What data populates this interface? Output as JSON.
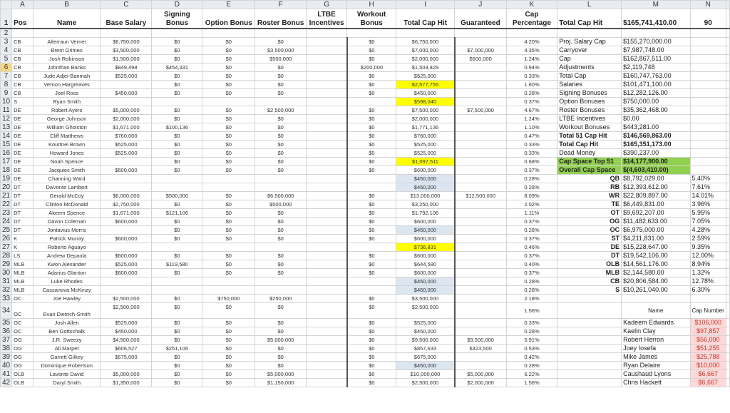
{
  "columns": [
    "A",
    "B",
    "C",
    "D",
    "E",
    "F",
    "G",
    "H",
    "I",
    "J",
    "K",
    "L",
    "M",
    "N"
  ],
  "header": {
    "pos": "Pos",
    "name": "Name",
    "base": "Base Salary",
    "signing": "Signing Bonus",
    "option": "Option Bonus",
    "roster": "Roster Bonus",
    "ltbe": "LTBE Incentives",
    "workout": "Workout Bonus",
    "total": "Total Cap Hit",
    "guaranteed": "Guaranteed",
    "cap_pct": "Cap Percentage",
    "l_label": "Total Cap Hit",
    "m_value": "$165,741,410.00",
    "n_value": "90"
  },
  "players": [
    {
      "row": "3",
      "pos": "CB",
      "name": "Alterraun Verner",
      "base": "$6,750,000",
      "signing": "$0",
      "option": "$0",
      "roster": "$0",
      "ltbe": "",
      "workout": "$0",
      "total": "$6,750,000",
      "guaranteed": "",
      "pct": "4.20%",
      "hl": ""
    },
    {
      "row": "4",
      "pos": "CB",
      "name": "Brent Grimes",
      "base": "$3,500,000",
      "signing": "$0",
      "option": "$0",
      "roster": "$3,500,000",
      "ltbe": "",
      "workout": "$0",
      "total": "$7,000,000",
      "guaranteed": "$7,000,000",
      "pct": "4.35%",
      "hl": ""
    },
    {
      "row": "5",
      "pos": "CB",
      "name": "Josh Robinson",
      "base": "$1,500,000",
      "signing": "$0",
      "option": "$0",
      "roster": "$500,000",
      "ltbe": "",
      "workout": "$0",
      "total": "$2,000,000",
      "guaranteed": "$500,000",
      "pct": "1.24%",
      "hl": ""
    },
    {
      "row": "6",
      "pos": "CB",
      "name": "Johnthan Banks",
      "base": "$849,498",
      "signing": "$454,331",
      "option": "$0",
      "roster": "$0",
      "ltbe": "",
      "workout": "$200,000",
      "total": "$1,503,829",
      "guaranteed": "",
      "pct": "0.94%",
      "hl": ""
    },
    {
      "row": "7",
      "pos": "CB",
      "name": "Jude Adjei-Barimah",
      "base": "$525,000",
      "signing": "$0",
      "option": "$0",
      "roster": "$0",
      "ltbe": "",
      "workout": "$0",
      "total": "$525,000",
      "guaranteed": "",
      "pct": "0.33%",
      "hl": ""
    },
    {
      "row": "8",
      "pos": "CB",
      "name": "Vernon Hargreaves",
      "base": "",
      "signing": "$0",
      "option": "$0",
      "roster": "$0",
      "ltbe": "",
      "workout": "$0",
      "total": "$2,577,755",
      "guaranteed": "",
      "pct": "1.60%",
      "hl": "yellow"
    },
    {
      "row": "9",
      "pos": "CB",
      "name": "Joel Ross",
      "base": "$450,000",
      "signing": "$0",
      "option": "$0",
      "roster": "$0",
      "ltbe": "",
      "workout": "$0",
      "total": "$450,000",
      "guaranteed": "",
      "pct": "0.28%",
      "hl": ""
    },
    {
      "row": "10",
      "pos": "S",
      "name": "Ryan Smith",
      "base": "",
      "signing": "",
      "option": "",
      "roster": "",
      "ltbe": "",
      "workout": "",
      "total": "$598,040",
      "guaranteed": "",
      "pct": "0.37%",
      "hl": "yellow"
    },
    {
      "row": "11",
      "pos": "DE",
      "name": "Robert Ayers",
      "base": "$5,000,000",
      "signing": "$0",
      "option": "$0",
      "roster": "$2,500,000",
      "ltbe": "",
      "workout": "$0",
      "total": "$7,500,000",
      "guaranteed": "$7,500,000",
      "pct": "4.67%",
      "hl": ""
    },
    {
      "row": "12",
      "pos": "DE",
      "name": "George Johnson",
      "base": "$2,000,000",
      "signing": "$0",
      "option": "$0",
      "roster": "$0",
      "ltbe": "",
      "workout": "$0",
      "total": "$2,000,000",
      "guaranteed": "",
      "pct": "1.24%",
      "hl": ""
    },
    {
      "row": "13",
      "pos": "DE",
      "name": "William Gholston",
      "base": "$1,671,000",
      "signing": "$100,136",
      "option": "$0",
      "roster": "$0",
      "ltbe": "",
      "workout": "$0",
      "total": "$1,771,136",
      "guaranteed": "",
      "pct": "1.10%",
      "hl": ""
    },
    {
      "row": "14",
      "pos": "DE",
      "name": "Cliff Matthews",
      "base": "$760,000",
      "signing": "$0",
      "option": "$0",
      "roster": "$0",
      "ltbe": "",
      "workout": "$0",
      "total": "$760,000",
      "guaranteed": "",
      "pct": "0.47%",
      "hl": ""
    },
    {
      "row": "15",
      "pos": "DE",
      "name": "Kourtnei Brown",
      "base": "$525,000",
      "signing": "$0",
      "option": "$0",
      "roster": "$0",
      "ltbe": "",
      "workout": "$0",
      "total": "$525,000",
      "guaranteed": "",
      "pct": "0.33%",
      "hl": ""
    },
    {
      "row": "16",
      "pos": "DE",
      "name": "Howard Jones",
      "base": "$525,000",
      "signing": "$0",
      "option": "$0",
      "roster": "$0",
      "ltbe": "",
      "workout": "$0",
      "total": "$525,000",
      "guaranteed": "",
      "pct": "0.33%",
      "hl": ""
    },
    {
      "row": "17",
      "pos": "DE",
      "name": "Noah Spence",
      "base": "",
      "signing": "$0",
      "option": "$0",
      "roster": "$0",
      "ltbe": "",
      "workout": "$0",
      "total": "$1,097,511",
      "guaranteed": "",
      "pct": "0.68%",
      "hl": "yellow"
    },
    {
      "row": "18",
      "pos": "DE",
      "name": "Jacquies Smith",
      "base": "$600,000",
      "signing": "$0",
      "option": "$0",
      "roster": "$0",
      "ltbe": "",
      "workout": "$0",
      "total": "$600,000",
      "guaranteed": "",
      "pct": "0.37%",
      "hl": ""
    },
    {
      "row": "19",
      "pos": "DE",
      "name": "Channing Ward",
      "base": "",
      "signing": "",
      "option": "",
      "roster": "",
      "ltbe": "",
      "workout": "",
      "total": "$450,000",
      "guaranteed": "",
      "pct": "0.28%",
      "hl": "blue"
    },
    {
      "row": "20",
      "pos": "DT",
      "name": "DaVonte Lambert",
      "base": "",
      "signing": "",
      "option": "",
      "roster": "",
      "ltbe": "",
      "workout": "",
      "total": "$450,000",
      "guaranteed": "",
      "pct": "0.28%",
      "hl": "blue"
    },
    {
      "row": "21",
      "pos": "DT",
      "name": "Gerald McCoy",
      "base": "$6,000,000",
      "signing": "$500,000",
      "option": "$0",
      "roster": "$6,500,000",
      "ltbe": "",
      "workout": "$0",
      "total": "$13,000,000",
      "guaranteed": "$12,500,000",
      "pct": "8.09%",
      "hl": ""
    },
    {
      "row": "22",
      "pos": "DT",
      "name": "Clinton McDonald",
      "base": "$2,750,000",
      "signing": "$0",
      "option": "$0",
      "roster": "$500,000",
      "ltbe": "",
      "workout": "$0",
      "total": "$3,250,000",
      "guaranteed": "",
      "pct": "2.02%",
      "hl": ""
    },
    {
      "row": "23",
      "pos": "DT",
      "name": "Akeem Spence",
      "base": "$1,671,000",
      "signing": "$121,106",
      "option": "$0",
      "roster": "$0",
      "ltbe": "",
      "workout": "$0",
      "total": "$1,792,106",
      "guaranteed": "",
      "pct": "1.11%",
      "hl": ""
    },
    {
      "row": "24",
      "pos": "DT",
      "name": "Davon Coleman",
      "base": "$600,000",
      "signing": "$0",
      "option": "$0",
      "roster": "$0",
      "ltbe": "",
      "workout": "$0",
      "total": "$600,000",
      "guaranteed": "",
      "pct": "0.37%",
      "hl": ""
    },
    {
      "row": "25",
      "pos": "DT",
      "name": "Jontavius Morris",
      "base": "",
      "signing": "$0",
      "option": "$0",
      "roster": "$0",
      "ltbe": "",
      "workout": "$0",
      "total": "$450,000",
      "guaranteed": "",
      "pct": "0.28%",
      "hl": "blue"
    },
    {
      "row": "26",
      "pos": "K",
      "name": "Patrick Murray",
      "base": "$600,000",
      "signing": "$0",
      "option": "$0",
      "roster": "$0",
      "ltbe": "",
      "workout": "$0",
      "total": "$600,000",
      "guaranteed": "",
      "pct": "0.37%",
      "hl": ""
    },
    {
      "row": "27",
      "pos": "K",
      "name": "Roberto Aguayo",
      "base": "",
      "signing": "",
      "option": "",
      "roster": "",
      "ltbe": "",
      "workout": "",
      "total": "$736,831",
      "guaranteed": "",
      "pct": "0.46%",
      "hl": "yellow"
    },
    {
      "row": "28",
      "pos": "LS",
      "name": "Andrew Depaola",
      "base": "$600,000",
      "signing": "$0",
      "option": "$0",
      "roster": "$0",
      "ltbe": "",
      "workout": "$0",
      "total": "$600,000",
      "guaranteed": "",
      "pct": "0.37%",
      "hl": ""
    },
    {
      "row": "29",
      "pos": "MLB",
      "name": "Kwon Alexander",
      "base": "$525,000",
      "signing": "$119,580",
      "option": "$0",
      "roster": "$0",
      "ltbe": "",
      "workout": "$0",
      "total": "$644,580",
      "guaranteed": "",
      "pct": "0.40%",
      "hl": ""
    },
    {
      "row": "30",
      "pos": "MLB",
      "name": "Adarius Glanton",
      "base": "$600,000",
      "signing": "$0",
      "option": "$0",
      "roster": "$0",
      "ltbe": "",
      "workout": "$0",
      "total": "$600,000",
      "guaranteed": "",
      "pct": "0.37%",
      "hl": ""
    },
    {
      "row": "31",
      "pos": "MLB",
      "name": "Luke Rhodes",
      "base": "",
      "signing": "",
      "option": "",
      "roster": "",
      "ltbe": "",
      "workout": "",
      "total": "$450,000",
      "guaranteed": "",
      "pct": "0.28%",
      "hl": "blue"
    },
    {
      "row": "32",
      "pos": "MLB",
      "name": "Cassanova McKinzy",
      "base": "",
      "signing": "",
      "option": "",
      "roster": "",
      "ltbe": "",
      "workout": "",
      "total": "$450,000",
      "guaranteed": "",
      "pct": "0.28%",
      "hl": "blue"
    },
    {
      "row": "33",
      "pos": "OC",
      "name": "Joe Hawley",
      "base": "$2,500,000",
      "signing": "$0",
      "option": "$750,000",
      "roster": "$250,000",
      "ltbe": "",
      "workout": "$0",
      "total": "$3,500,000",
      "guaranteed": "",
      "pct": "2.18%",
      "hl": ""
    },
    {
      "row": "34",
      "pos": "OC",
      "name": "Evan Dietrich-Smith",
      "base": "$2,500,000",
      "signing": "$0",
      "option": "$0",
      "roster": "$0",
      "ltbe": "",
      "workout": "$0",
      "total": "$2,500,000",
      "guaranteed": "",
      "pct": "1.56%",
      "hl": "",
      "tall": true
    },
    {
      "row": "35",
      "pos": "OC",
      "name": "Josh Allen",
      "base": "$525,000",
      "signing": "$0",
      "option": "$0",
      "roster": "$0",
      "ltbe": "",
      "workout": "$0",
      "total": "$525,000",
      "guaranteed": "",
      "pct": "0.33%",
      "hl": ""
    },
    {
      "row": "36",
      "pos": "OC",
      "name": "Ben Gottschalk",
      "base": "$450,000",
      "signing": "$0",
      "option": "$0",
      "roster": "$0",
      "ltbe": "",
      "workout": "$0",
      "total": "$450,000",
      "guaranteed": "",
      "pct": "0.28%",
      "hl": ""
    },
    {
      "row": "37",
      "pos": "OG",
      "name": "J.R. Sweezy",
      "base": "$4,500,000",
      "signing": "$0",
      "option": "$0",
      "roster": "$5,000,000",
      "ltbe": "",
      "workout": "$0",
      "total": "$9,500,000",
      "guaranteed": "$9,500,000",
      "pct": "5.91%",
      "hl": ""
    },
    {
      "row": "38",
      "pos": "OG",
      "name": "Ali Marpet",
      "base": "$606,527",
      "signing": "$251,106",
      "option": "$0",
      "roster": "$0",
      "ltbe": "",
      "workout": "$0",
      "total": "$857,633",
      "guaranteed": "$323,500",
      "pct": "0.53%",
      "hl": ""
    },
    {
      "row": "39",
      "pos": "OG",
      "name": "Garrett Gilkey",
      "base": "$675,000",
      "signing": "$0",
      "option": "$0",
      "roster": "$0",
      "ltbe": "",
      "workout": "$0",
      "total": "$675,000",
      "guaranteed": "",
      "pct": "0.42%",
      "hl": ""
    },
    {
      "row": "40",
      "pos": "OG",
      "name": "Dominique Robertson",
      "base": "",
      "signing": "$0",
      "option": "$0",
      "roster": "$0",
      "ltbe": "",
      "workout": "$0",
      "total": "$450,000",
      "guaranteed": "",
      "pct": "0.28%",
      "hl": "blue"
    },
    {
      "row": "41",
      "pos": "OLB",
      "name": "Lavonte David",
      "base": "$5,000,000",
      "signing": "$0",
      "option": "$0",
      "roster": "$5,000,000",
      "ltbe": "",
      "workout": "$0",
      "total": "$10,000,000",
      "guaranteed": "$5,000,000",
      "pct": "6.22%",
      "hl": ""
    },
    {
      "row": "42",
      "pos": "OLB",
      "name": "Daryl Smith",
      "base": "$1,350,000",
      "signing": "$0",
      "option": "$0",
      "roster": "$1,150,000",
      "ltbe": "",
      "workout": "$0",
      "total": "$2,500,000",
      "guaranteed": "$2,000,000",
      "pct": "1.56%",
      "hl": ""
    }
  ],
  "summary": [
    {
      "label": "Proj. Salary Cap",
      "value": "$155,270,000.00",
      "bold": false,
      "green": false
    },
    {
      "label": "Carryover",
      "value": "$7,987,748.00",
      "bold": false,
      "green": false
    },
    {
      "label": "Cap",
      "value": "$162,867,511.00",
      "bold": false,
      "green": false
    },
    {
      "label": "Adjustments",
      "value": "$2,119,748",
      "bold": false,
      "green": false
    },
    {
      "label": "Total Cap",
      "value": "$160,747,763.00",
      "bold": false,
      "green": false
    },
    {
      "label": "Salaries",
      "value": "$101,471,100.00",
      "bold": false,
      "green": false
    },
    {
      "label": "Signing Bonuses",
      "value": "$12,282,126.00",
      "bold": false,
      "green": false
    },
    {
      "label": "Option Bonuses",
      "value": "$750,000.00",
      "bold": false,
      "green": false
    },
    {
      "label": "Roster Bonuses",
      "value": "$35,362,468.00",
      "bold": false,
      "green": false
    },
    {
      "label": "LTBE Incentives",
      "value": "$0.00",
      "bold": false,
      "green": false
    },
    {
      "label": "Workout Bonuses",
      "value": "$443,281.00",
      "bold": false,
      "green": false
    },
    {
      "label": "Total 51 Cap Hit",
      "value": "$146,569,863.00",
      "bold": true,
      "green": false
    },
    {
      "label": "Total Cap Hit",
      "value": "$165,351,173.00",
      "bold": true,
      "green": false
    },
    {
      "label": "Dead Money",
      "value": "$390,237.00",
      "bold": false,
      "green": false
    },
    {
      "label": "Cap Space Top 51",
      "value": "$14,177,900.00",
      "bold": true,
      "green": true
    },
    {
      "label": "Overall Cap Space",
      "value": "$(4,603,410.00)",
      "bold": true,
      "green": true
    }
  ],
  "positions": [
    {
      "pos": "QB",
      "value": "$8,792,029.00",
      "pct": "5.40%"
    },
    {
      "pos": "RB",
      "value": "$12,393,612.00",
      "pct": "7.61%"
    },
    {
      "pos": "WR",
      "value": "$22,809,897.00",
      "pct": "14.01%"
    },
    {
      "pos": "TE",
      "value": "$6,449,831.00",
      "pct": "3.96%"
    },
    {
      "pos": "OT",
      "value": "$9,692,207.00",
      "pct": "5.95%"
    },
    {
      "pos": "OG",
      "value": "$11,482,633.00",
      "pct": "7.05%"
    },
    {
      "pos": "OC",
      "value": "$6,975,000.00",
      "pct": "4.28%"
    },
    {
      "pos": "ST",
      "value": "$4,211,831.00",
      "pct": "2.59%"
    },
    {
      "pos": "DE",
      "value": "$15,228,647.00",
      "pct": "9.35%"
    },
    {
      "pos": "DT",
      "value": "$19,542,106.00",
      "pct": "12.00%"
    },
    {
      "pos": "OLB",
      "value": "$14,561,176.00",
      "pct": "8.94%"
    },
    {
      "pos": "MLB",
      "value": "$2,144,580.00",
      "pct": "1.32%"
    },
    {
      "pos": "CB",
      "value": "$20,806,584.00",
      "pct": "12.78%"
    },
    {
      "pos": "S",
      "value": "$10,261,040.00",
      "pct": "6.30%"
    }
  ],
  "dead_table": {
    "name_header": "Name",
    "cap_header": "Cap Number",
    "rows": [
      {
        "name": "Kadeem Edwards",
        "cap": "$106,000"
      },
      {
        "name": "Kaelin Clay",
        "cap": "$97,857"
      },
      {
        "name": "Robert Herron",
        "cap": "$56,000"
      },
      {
        "name": "Joey Iosefa",
        "cap": "$51,255"
      },
      {
        "name": "Mike James",
        "cap": "$25,788"
      },
      {
        "name": "Ryan Delaire",
        "cap": "$10,000"
      },
      {
        "name": "Caushaud Lyons",
        "cap": "$6,667"
      },
      {
        "name": "Chris Hackett",
        "cap": "$6,667"
      }
    ]
  },
  "row_labels": {
    "r1": "1",
    "r2": "2"
  },
  "colors": {
    "yellow": "#ffff00",
    "blue": "#dce6f1",
    "green": "#92d050",
    "pink": "#ffd9d9",
    "red_text": "#c0392b",
    "active_row": "#f9d77e"
  }
}
